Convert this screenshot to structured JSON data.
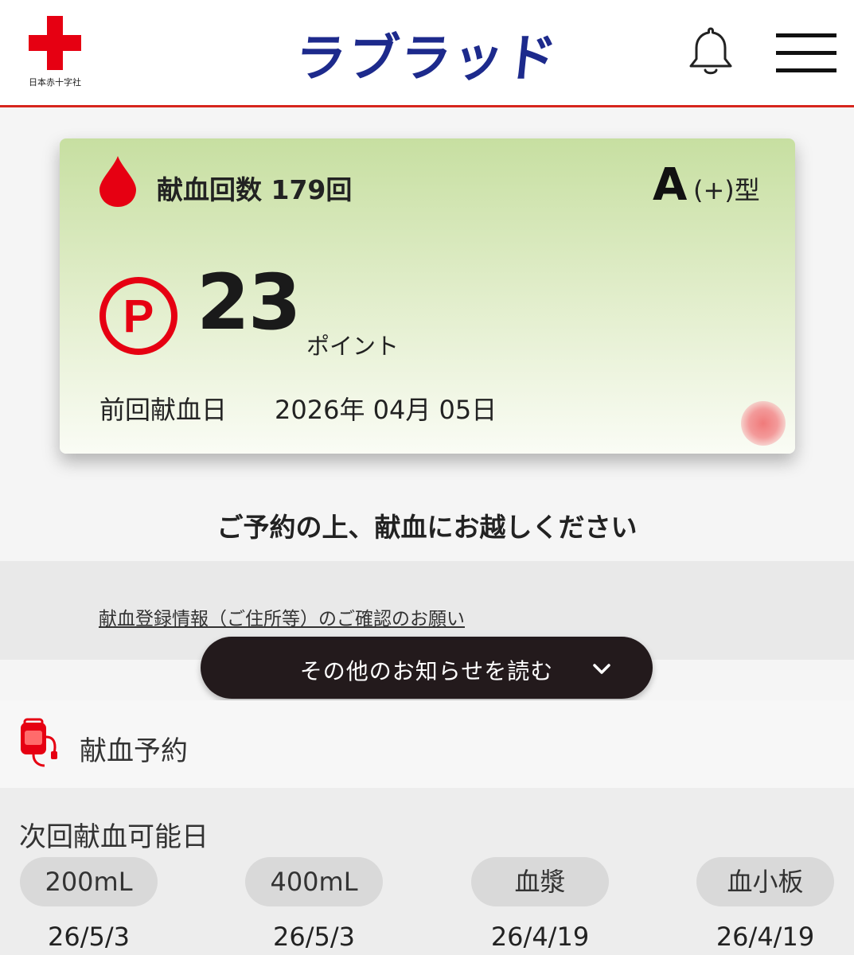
{
  "header": {
    "org_name": "日本赤十字社",
    "app_title": "ラブラッド",
    "icons": {
      "logo": "red-cross-logo",
      "notifications": "bell-icon",
      "menu": "hamburger-menu-icon"
    }
  },
  "card": {
    "donation_count_label": "献血回数 179回",
    "blood_type_letter": "A",
    "blood_type_suffix": "(+)型",
    "points_value": "23",
    "points_unit": "ポイント",
    "last_donation_label": "前回献血日",
    "last_donation_date": "2026年 04月 05日",
    "colors": {
      "gradient_top": "#c7dfa1",
      "gradient_bottom": "#fafcf5",
      "accent_red": "#e60012"
    }
  },
  "reservation_message": "ご予約の上、献血にお越しください",
  "notices": {
    "link_text": "献血登録情報（ご住所等）のご確認のお願い",
    "more_button_label": "その他のお知らせを読む"
  },
  "reservation": {
    "label": "献血予約"
  },
  "next_possible": {
    "title": "次回献血可能日",
    "items": [
      {
        "type": "200mL",
        "date": "26/5/3"
      },
      {
        "type": "400mL",
        "date": "26/5/3"
      },
      {
        "type": "血漿",
        "date": "26/4/19"
      },
      {
        "type": "血小板",
        "date": "26/4/19"
      }
    ]
  }
}
